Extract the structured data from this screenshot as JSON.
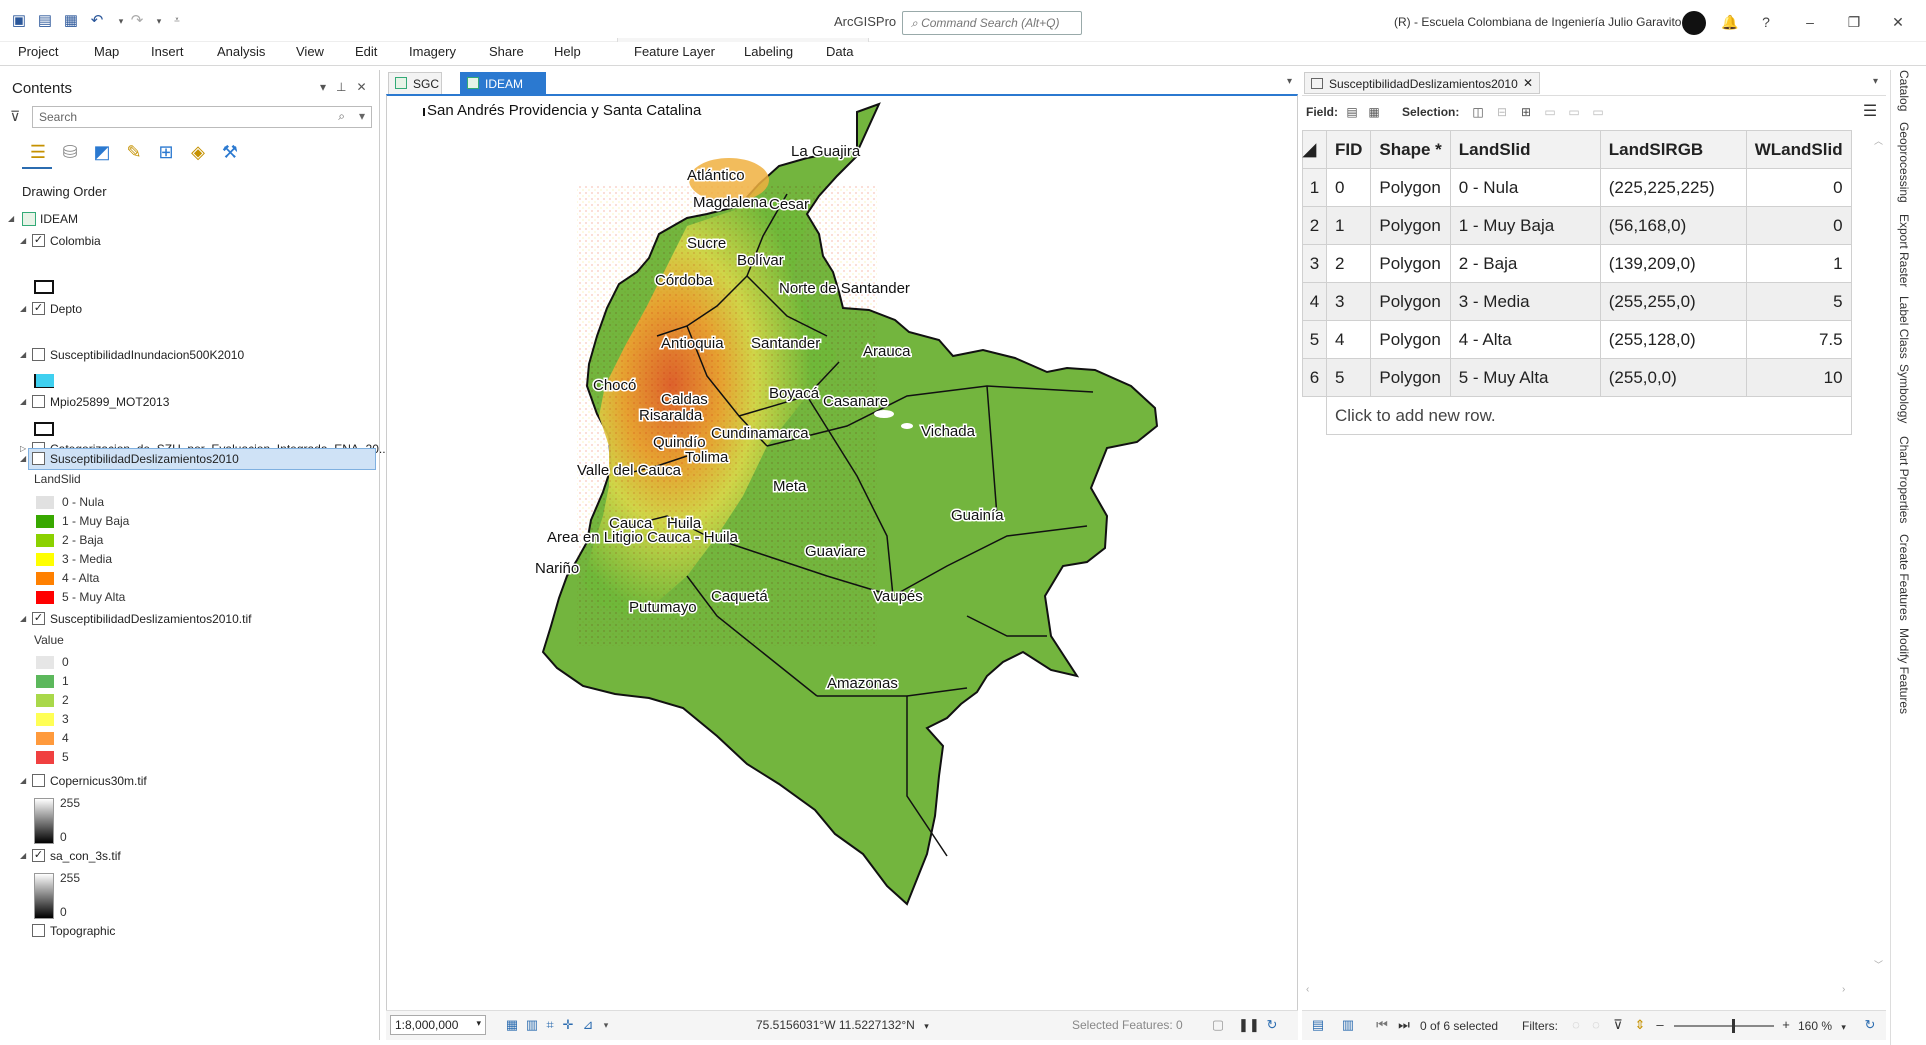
{
  "titlebar": {
    "app_name": "ArcGISPro",
    "command_search_placeholder": "Command Search (Alt+Q)",
    "user_org": "(R) - Escuela Colombiana de Ingeniería Julio Garavito",
    "icons": [
      "new-project-icon",
      "open-project-icon",
      "save-icon",
      "undo-icon",
      "redo-icon",
      "customize-icon"
    ]
  },
  "menu": {
    "items": [
      "Project",
      "Map",
      "Insert",
      "Analysis",
      "View",
      "Edit",
      "Imagery",
      "Share",
      "Help"
    ],
    "contextual": [
      "Feature Layer",
      "Labeling",
      "Data"
    ]
  },
  "contents": {
    "title": "Contents",
    "search_placeholder": "Search",
    "drawing_order": "Drawing Order",
    "map_name": "IDEAM",
    "layers": {
      "colombia": {
        "name": "Colombia",
        "checked": true
      },
      "depto": {
        "name": "Depto",
        "checked": true
      },
      "inundacion": {
        "name": "SusceptibilidadInundacion500K2010",
        "checked": false,
        "color": "#3fd0f0"
      },
      "mpio": {
        "name": "Mpio25899_MOT2013",
        "checked": false
      },
      "categorizacion": {
        "name": "Categorizacion_de_SZH_por_Evaluacion_Integrada_ENA_20...",
        "checked": false
      },
      "deslizamientos": {
        "name": "SusceptibilidadDeslizamientos2010",
        "checked": false,
        "field": "LandSlid",
        "classes": [
          {
            "label": "0 - Nula",
            "color": "#e1e1e1"
          },
          {
            "label": "1 - Muy Baja",
            "color": "#38a800"
          },
          {
            "label": "2 - Baja",
            "color": "#8bd100"
          },
          {
            "label": "3 - Media",
            "color": "#ffff00"
          },
          {
            "label": "4 - Alta",
            "color": "#ff8000"
          },
          {
            "label": "5 - Muy Alta",
            "color": "#ff0000"
          }
        ]
      },
      "deslizamientos_tif": {
        "name": "SusceptibilidadDeslizamientos2010.tif",
        "checked": true,
        "field": "Value",
        "classes": [
          {
            "label": "0",
            "color": "#e6e6e6"
          },
          {
            "label": "1",
            "color": "#5cb85c"
          },
          {
            "label": "2",
            "color": "#a9d84a"
          },
          {
            "label": "3",
            "color": "#ffff55"
          },
          {
            "label": "4",
            "color": "#ff9a3c"
          },
          {
            "label": "5",
            "color": "#f04040"
          }
        ]
      },
      "copernicus": {
        "name": "Copernicus30m.tif",
        "checked": false,
        "max": "255",
        "min": "0"
      },
      "sa_con": {
        "name": "sa_con_3s.tif",
        "checked": true,
        "max": "255",
        "min": "0"
      },
      "topographic": {
        "name": "Topographic",
        "checked": false
      }
    }
  },
  "map": {
    "tabs": [
      "SGC",
      "IDEAM"
    ],
    "active_tab": "IDEAM",
    "inset_label": "San Andrés Providencia y Santa Catalina",
    "departments": [
      "La Guajira",
      "Atlántico",
      "Magdalena",
      "Cesar",
      "Sucre",
      "Bolívar",
      "Córdoba",
      "Norte de Santander",
      "Antioquia",
      "Santander",
      "Arauca",
      "Chocó",
      "Caldas",
      "Boyacá",
      "Casanare",
      "Risaralda",
      "Quindío",
      "Cundinamarca",
      "Vichada",
      "Tolima",
      "Valle del Cauca",
      "Meta",
      "Cauca",
      "Huila",
      "Guainía",
      "Area en Litigio Cauca - Huila",
      "Guaviare",
      "Nariño",
      "Caquetá",
      "Vaupés",
      "Putumayo",
      "Amazonas"
    ],
    "scale": "1:8,000,000",
    "coordinates": "75.5156031°W 11.5227132°N",
    "selected_features": "Selected Features: 0"
  },
  "attribute_table": {
    "tab_title": "SusceptibilidadDeslizamientos2010",
    "field_label": "Field:",
    "selection_label": "Selection:",
    "columns": [
      "FID",
      "Shape *",
      "LandSlid",
      "LandSlRGB",
      "WLandSlid"
    ],
    "rows": [
      {
        "n": "1",
        "fid": "0",
        "shape": "Polygon",
        "landslid": "0 - Nula",
        "rgb": "(225,225,225)",
        "w": "0"
      },
      {
        "n": "2",
        "fid": "1",
        "shape": "Polygon",
        "landslid": "1 - Muy Baja",
        "rgb": "(56,168,0)",
        "w": "0"
      },
      {
        "n": "3",
        "fid": "2",
        "shape": "Polygon",
        "landslid": "2 - Baja",
        "rgb": "(139,209,0)",
        "w": "1"
      },
      {
        "n": "4",
        "fid": "3",
        "shape": "Polygon",
        "landslid": "3 - Media",
        "rgb": "(255,255,0)",
        "w": "5"
      },
      {
        "n": "5",
        "fid": "4",
        "shape": "Polygon",
        "landslid": "4 - Alta",
        "rgb": "(255,128,0)",
        "w": "7.5"
      },
      {
        "n": "6",
        "fid": "5",
        "shape": "Polygon",
        "landslid": "5 - Muy Alta",
        "rgb": "(255,0,0)",
        "w": "10"
      }
    ],
    "add_row_hint": "Click to add new row.",
    "record_count": "0 of 6 selected",
    "filters_label": "Filters:",
    "zoom": "160 %"
  },
  "dock": [
    "Catalog",
    "Geoprocessing",
    "Export Raster",
    "Label Class",
    "Symbology",
    "Chart Properties",
    "Create Features",
    "Modify Features"
  ]
}
